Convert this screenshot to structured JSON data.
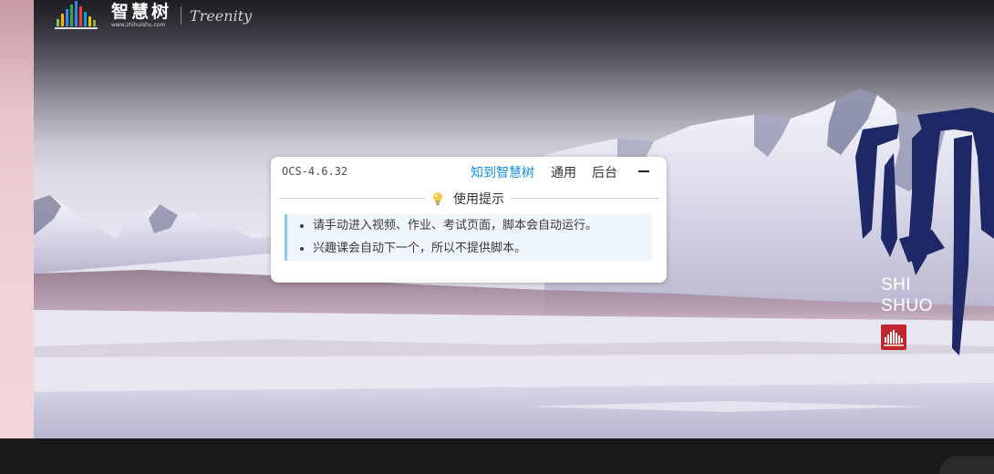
{
  "logo": {
    "name_cn": "智慧树",
    "url": "www.zhihuishu.com",
    "brand": "Treenity"
  },
  "calligraphy": {
    "line1": "SHI",
    "line2": "SHUO",
    "seal_icon": "sound-wave-seal-icon"
  },
  "panel": {
    "version": "OCS-4.6.32",
    "tabs": [
      {
        "label": "知到智慧树",
        "active": true
      },
      {
        "label": "通用",
        "active": false
      },
      {
        "label": "后台",
        "active": false
      }
    ],
    "minimize_icon": "minus-icon",
    "section_icon": "lightbulb-icon",
    "section_title": "使用提示",
    "tips": [
      "请手动进入视频、作业、考试页面，脚本会自动运行。",
      "兴趣课会自动下一个，所以不提供脚本。"
    ]
  },
  "colors": {
    "accent": "#1a8fd6",
    "tip_background": "#eef6fc",
    "tip_border": "#8ccbf1",
    "seal": "#c2272f",
    "calligraphy": "#1f2866"
  }
}
